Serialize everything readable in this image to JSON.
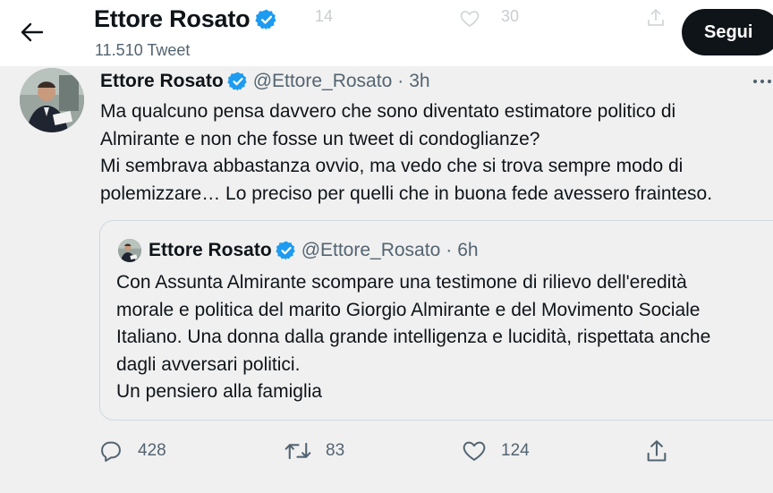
{
  "header": {
    "name": "Ettore Rosato",
    "tweet_count": "11.510 Tweet",
    "follow_label": "Segui",
    "ghost_counts": [
      "14",
      "30"
    ]
  },
  "tweet": {
    "author_name": "Ettore Rosato",
    "handle": "@Ettore_Rosato",
    "separator": "·",
    "time": "3h",
    "text": "Ma qualcuno pensa davvero che sono diventato estimatore politico di\nAlmirante e non che fosse un tweet di condoglianze?\nMi sembrava abbastanza ovvio, ma vedo che si trova sempre modo di\npolemizzare… Lo preciso per quelli che in buona fede avessero frainteso."
  },
  "quoted": {
    "author_name": "Ettore Rosato",
    "handle": "@Ettore_Rosato",
    "separator": "·",
    "time": "6h",
    "text": "Con Assunta Almirante scompare una testimone di rilievo dell'eredità\nmorale e politica del marito Giorgio Almirante e del Movimento Sociale\nItaliano. Una donna dalla grande intelligenza e lucidità, rispettata anche\ndagli avversari politici.\nUn pensiero alla famiglia"
  },
  "actions": {
    "replies": "428",
    "retweets": "83",
    "likes": "124"
  },
  "icons": {
    "back": "arrow-left-icon",
    "verified": "verified-badge-icon",
    "more": "more-horizontal-icon",
    "reply": "reply-icon",
    "retweet": "retweet-icon",
    "like": "heart-icon",
    "share": "share-icon"
  },
  "colors": {
    "verified_blue": "#1d9bf0",
    "follow_button": "#0f1419",
    "secondary_text": "#536471",
    "background": "#f0f0f0"
  }
}
